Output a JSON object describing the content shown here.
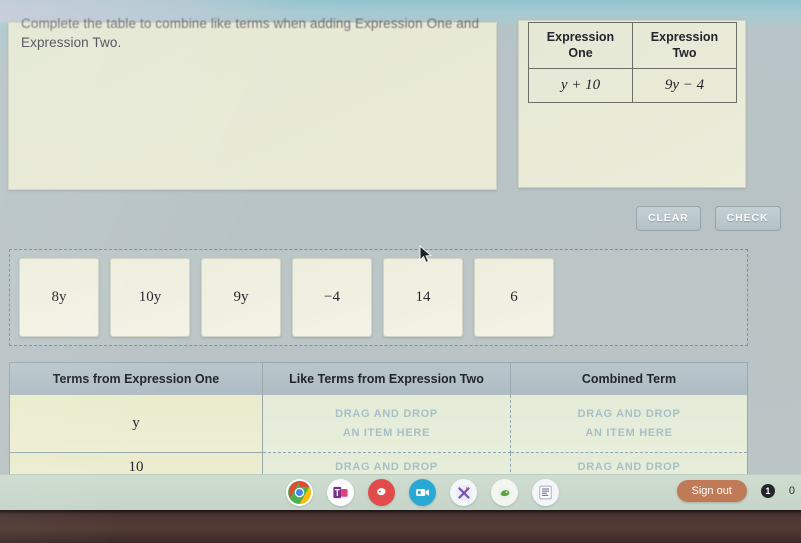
{
  "instruction": {
    "line1": "Complete the table to combine like terms when adding Expression One and",
    "line2": "Expression Two."
  },
  "expression_table": {
    "headers": [
      "Expression One",
      "Expression Two"
    ],
    "header_one_top": "Expression",
    "header_one_bottom": "One",
    "header_two_top": "Expression",
    "header_two_bottom": "Two",
    "expression_one": "y + 10",
    "expression_two": "9y − 4"
  },
  "actions": {
    "clear_label": "CLEAR",
    "check_label": "CHECK"
  },
  "tiles": [
    {
      "label": "8y"
    },
    {
      "label": "10y"
    },
    {
      "label": "9y"
    },
    {
      "label": "−4"
    },
    {
      "label": "14"
    },
    {
      "label": "6"
    }
  ],
  "answer_table": {
    "headers": [
      "Terms from Expression One",
      "Like Terms from Expression Two",
      "Combined Term"
    ],
    "dropzone_line1": "DRAG AND DROP",
    "dropzone_line2": "AN ITEM HERE",
    "rows": [
      {
        "term": "y"
      },
      {
        "term": "10"
      }
    ]
  },
  "taskbar": {
    "icons": [
      {
        "name": "chrome-icon",
        "glyph": ""
      },
      {
        "name": "microsoft-teams-icon",
        "glyph": ""
      },
      {
        "name": "pbs-kids-icon",
        "glyph": ""
      },
      {
        "name": "video-app-icon",
        "glyph": ""
      },
      {
        "name": "xtramath-icon",
        "glyph": "X"
      },
      {
        "name": "dragon-app-icon",
        "glyph": ""
      },
      {
        "name": "document-app-icon",
        "glyph": ""
      }
    ],
    "signout_label": "Sign out",
    "notification_count": "1",
    "clock": "0"
  },
  "colors": {
    "accent_signout": "#c07a57",
    "panel": "#e8ead6",
    "header_row": "#b3c1c8",
    "dropzone_text": "#a7bfc6"
  }
}
